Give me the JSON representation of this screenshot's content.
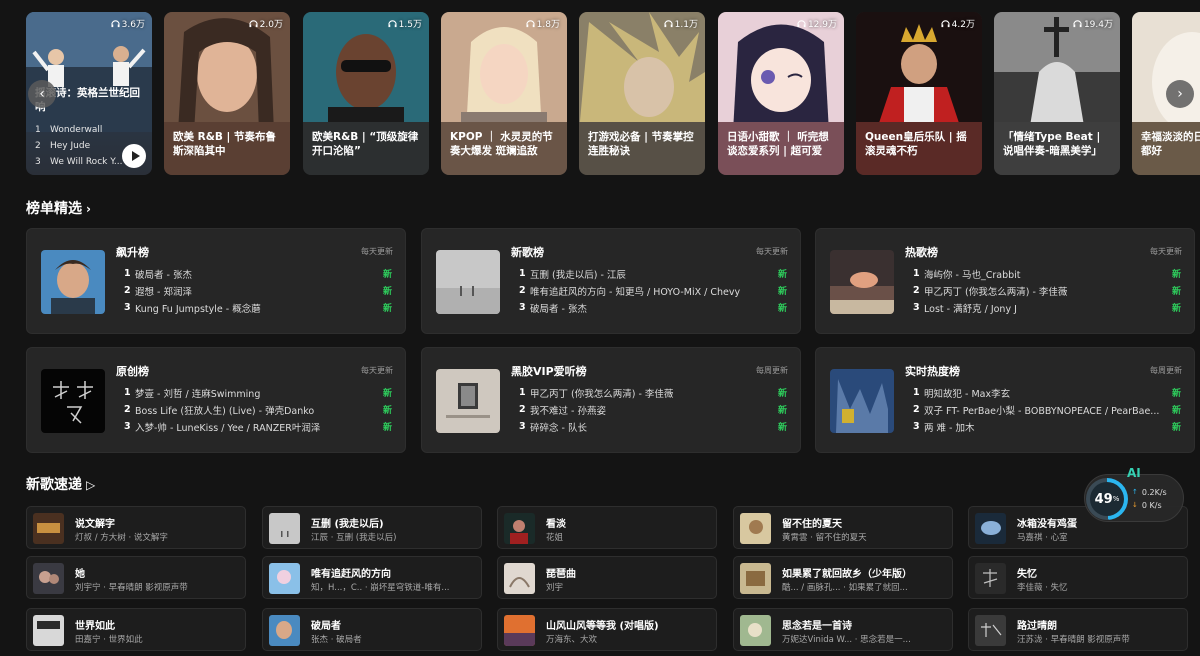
{
  "playlists": [
    {
      "plays": "3.6万",
      "title": "摇滚诗：英格兰世纪回响",
      "tracks": [
        {
          "n": "1",
          "name": "Wonderwall"
        },
        {
          "n": "2",
          "name": "Hey Jude"
        },
        {
          "n": "3",
          "name": "We Will Rock Y..."
        }
      ]
    },
    {
      "plays": "2.0万",
      "title": "欧美 R&B | 节奏布鲁斯深陷其中"
    },
    {
      "plays": "1.5万",
      "title": "欧美R&B | “顶级旋律开口沦陷”"
    },
    {
      "plays": "1.8万",
      "title": "KPOP ｜ 水灵灵的节奏大爆发 斑斓追敌"
    },
    {
      "plays": "1.1万",
      "title": "打游戏必备 | 节奏掌控连胜秘诀"
    },
    {
      "plays": "12.9万",
      "title": "日语小甜歌 ｜ 听完想谈恋爱系列 | 超可爱"
    },
    {
      "plays": "4.2万",
      "title": "Queen皇后乐队 | 摇滚灵魂不朽"
    },
    {
      "plays": "19.4万",
      "title": "「情绪Type Beat | 说唱伴奏-暗黑美学」"
    },
    {
      "plays": "",
      "title": "幸福淡淡的日常 祝我们都好"
    }
  ],
  "sections": {
    "charts_title": "榜单精选",
    "new_songs_title": "新歌速递"
  },
  "charts": [
    {
      "name": "飙升榜",
      "update": "每天更新",
      "rows": [
        {
          "idx": "1",
          "song": "破局者 - 张杰",
          "tag": "新"
        },
        {
          "idx": "2",
          "song": "遐想 - 郑润泽",
          "tag": "新"
        },
        {
          "idx": "3",
          "song": "Kung Fu Jumpstyle - 概念蘑",
          "tag": "新"
        }
      ]
    },
    {
      "name": "新歌榜",
      "update": "每天更新",
      "rows": [
        {
          "idx": "1",
          "song": "互删 (我走以后) - 江辰",
          "tag": "新"
        },
        {
          "idx": "2",
          "song": "唯有追赶风的方向 - 知更鸟 / HOYO-MiX / Chevy",
          "tag": "新"
        },
        {
          "idx": "3",
          "song": "破局者 - 张杰",
          "tag": "新"
        }
      ]
    },
    {
      "name": "热歌榜",
      "update": "每天更新",
      "rows": [
        {
          "idx": "1",
          "song": "海屿你 - 马也_Crabbit",
          "tag": "新"
        },
        {
          "idx": "2",
          "song": "甲乙丙丁 (你我怎么两清) - 李佳薇",
          "tag": "新"
        },
        {
          "idx": "3",
          "song": "Lost - 满舒克 / Jony J",
          "tag": "新"
        }
      ]
    },
    {
      "name": "原创榜",
      "update": "每天更新",
      "rows": [
        {
          "idx": "1",
          "song": "梦壹 - 刘哲 / 连麻Swimming",
          "tag": "新"
        },
        {
          "idx": "2",
          "song": "Boss Life (狂放人生) (Live) - 弹壳Danko",
          "tag": "新"
        },
        {
          "idx": "3",
          "song": "入梦-帅 - LuneKiss / Yee / RANZER叶润泽",
          "tag": "新"
        }
      ]
    },
    {
      "name": "黑胶VIP爱听榜",
      "update": "每周更新",
      "rows": [
        {
          "idx": "1",
          "song": "甲乙丙丁 (你我怎么两清) - 李佳薇",
          "tag": "新"
        },
        {
          "idx": "2",
          "song": "我不难过 - 孙燕姿",
          "tag": "新"
        },
        {
          "idx": "3",
          "song": "碎碎念 - 队长",
          "tag": "新"
        }
      ]
    },
    {
      "name": "实时热度榜",
      "update": "每周更新",
      "rows": [
        {
          "idx": "1",
          "song": "明知故犯 - Max李玄",
          "tag": "新"
        },
        {
          "idx": "2",
          "song": "双子 FT- PerBae小梨 - BOBBYNOPEACE / PearBae...",
          "tag": "新"
        },
        {
          "idx": "3",
          "song": "两 难 - 加木",
          "tag": "新"
        }
      ]
    }
  ],
  "new_songs": [
    {
      "name": "说文解字",
      "artist": "灯叔 / 方大树 · 说文解字"
    },
    {
      "name": "互删 (我走以后)",
      "artist": "江辰 · 互删 (我走以后)"
    },
    {
      "name": "看淡",
      "artist": "花姐"
    },
    {
      "name": "留不住的夏天",
      "artist": "黄霄雲 · 留不住的夏天"
    },
    {
      "name": "冰箱没有鸡蛋",
      "artist": "马嘉祺 · 心室"
    },
    {
      "name": "她",
      "artist": "刘宇宁 · 早春晴朗 影视原声带"
    },
    {
      "name": "唯有追赶风的方向",
      "artist": "知，H...，C.. · 崩坏星穹铁道-唯有..."
    },
    {
      "name": "琵琶曲",
      "artist": "刘宇"
    },
    {
      "name": "如果累了就回故乡（少年版）",
      "artist": "酷... / 画脉孔... · 如果累了就回..."
    },
    {
      "name": "失忆",
      "artist": "李佳薇 · 失忆"
    },
    {
      "name": "世界如此",
      "artist": "田嘉宁 · 世界如此"
    },
    {
      "name": "破局者",
      "artist": "张杰 · 破局者"
    },
    {
      "name": "山风山风等等我 (对唱版)",
      "artist": "万海东、大欢"
    },
    {
      "name": "思念若是一首诗",
      "artist": "万妮达Vinida W... · 思念若是一..."
    },
    {
      "name": "路过晴朗",
      "artist": "汪苏泷 · 早春晴朗 影视原声带"
    }
  ],
  "ai_widget": {
    "label": "AI",
    "percent": "49",
    "percent_unit": "%",
    "up": "0.2K/s",
    "down": "0 K/s"
  },
  "colors": {
    "new_tag": "#2ecc5c",
    "accent": "#2bb6f0",
    "background": "#141414"
  }
}
